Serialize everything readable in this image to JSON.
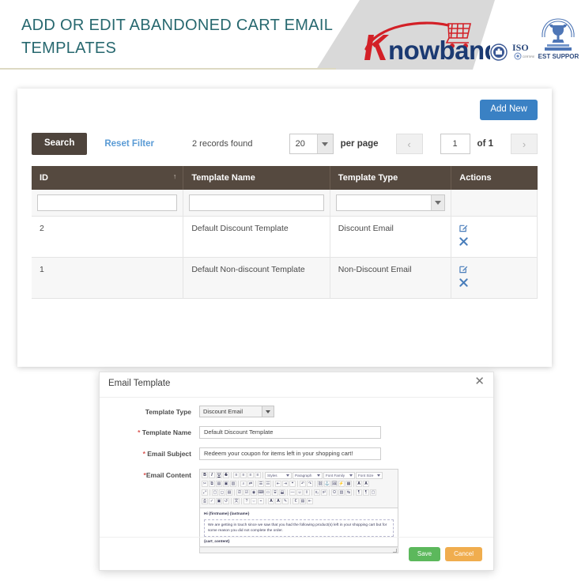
{
  "header": {
    "title": "Add or Edit Abandoned Cart Email Templates",
    "logo_text_brand": "nowband",
    "badges": [
      {
        "name": "certification-seal-badge",
        "label": ""
      },
      {
        "name": "iso-badge",
        "label": "ISO"
      },
      {
        "name": "best-support-badge",
        "label": "BEST SUPPORT"
      }
    ]
  },
  "panel": {
    "add_new_label": "Add New",
    "search_label": "Search",
    "reset_filter_label": "Reset Filter",
    "records_found": "2 records found",
    "per_page_value": "20",
    "per_page_label": "per page",
    "prev_label": "‹",
    "page_value": "1",
    "of_label": "of 1",
    "next_label": "›",
    "table": {
      "columns": [
        "ID",
        "Template Name",
        "Template Type",
        "Actions"
      ],
      "sort_indicator": "↑",
      "filters": {
        "id_value": "",
        "name_value": "",
        "type_value": ""
      },
      "rows": [
        {
          "id": "2",
          "name": "Default Discount Template",
          "type": "Discount Email",
          "edit_icon": "edit-icon",
          "delete_icon": "delete-icon"
        },
        {
          "id": "1",
          "name": "Default Non-discount Template",
          "type": "Non-Discount Email",
          "edit_icon": "edit-icon",
          "delete_icon": "delete-icon"
        }
      ]
    }
  },
  "modal": {
    "title": "Email Template",
    "close_label": "✕",
    "fields": {
      "template_type_label": "Template Type",
      "template_type_value": "Discount Email",
      "template_name_label": "Template Name",
      "template_name_required": "*",
      "template_name_value": "Default Discount Template",
      "email_subject_label": "Email Subject",
      "email_subject_required": "*",
      "email_subject_value": "Redeem your coupon for items left in your shopping cart!",
      "email_content_label": "Email Content",
      "email_content_required": "*"
    },
    "editor": {
      "toolbar_row1": [
        "B",
        "I",
        "U",
        "S"
      ],
      "align_buttons": [
        "≡",
        "≡",
        "≡",
        "≡"
      ],
      "dropdowns": [
        "Styles",
        "Paragraph",
        "Font Family",
        "Font Size"
      ],
      "greeting": "Hi {firstname} {lastname}",
      "body_text": "We are getting in touch since we saw that you had the following product(s) left in your shopping cart but for some reason you did not complete the order.",
      "cart_token": "{cart_content}"
    },
    "save_label": "Save",
    "cancel_label": "Cancel"
  },
  "colors": {
    "title": "#27686f",
    "header_grey": "#d9d9d9",
    "add_new": "#3a81c4",
    "search": "#4e443c",
    "reset_link": "#5a9bd5",
    "table_header": "#55493f",
    "action_icon": "#4a7ebb",
    "save": "#5cb85c",
    "cancel": "#f0ad4e",
    "required": "#d9534f",
    "logo_red": "#d32027",
    "logo_navy": "#1b3a72"
  }
}
